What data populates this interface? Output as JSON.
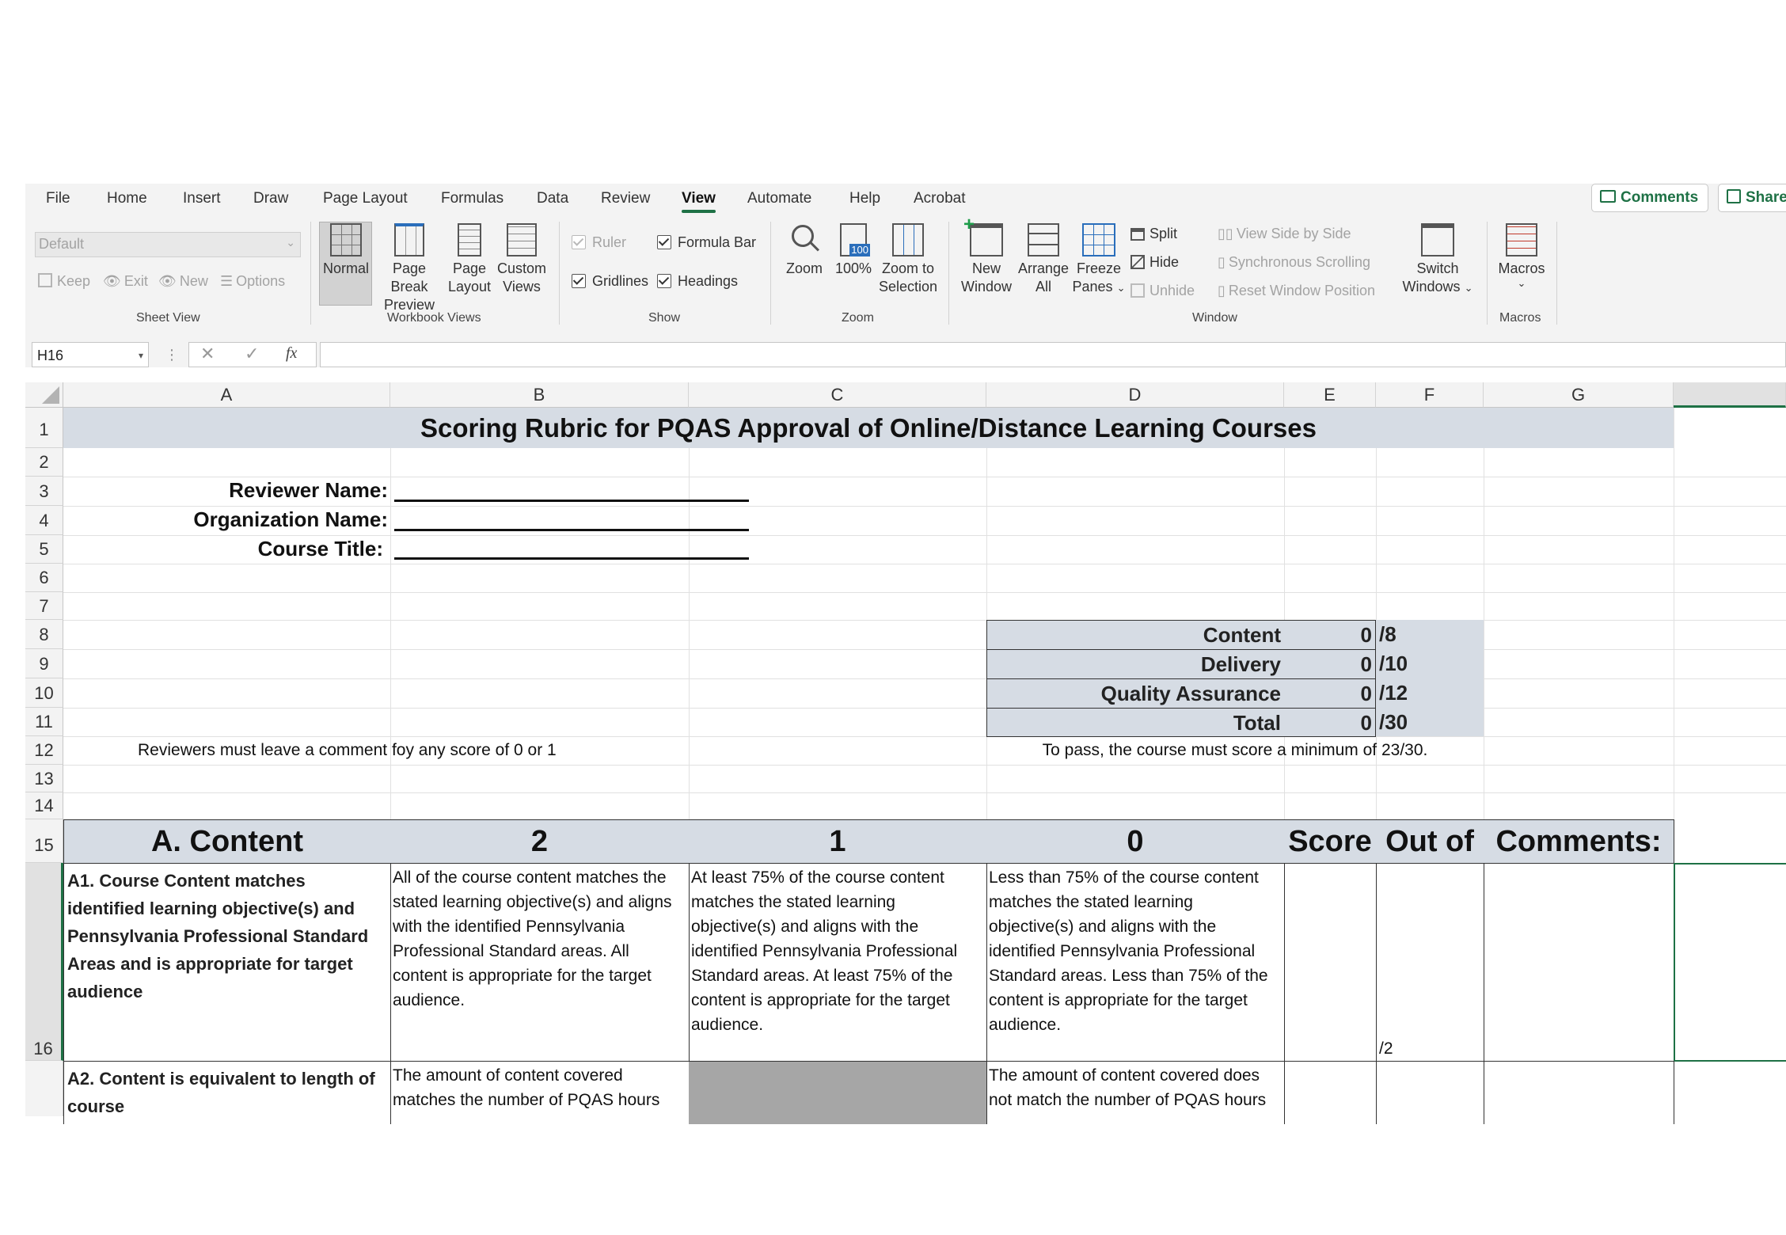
{
  "tabs": [
    "File",
    "Home",
    "Insert",
    "Draw",
    "Page Layout",
    "Formulas",
    "Data",
    "Review",
    "View",
    "Automate",
    "Help",
    "Acrobat"
  ],
  "active_tab": "View",
  "top_buttons": {
    "comments": "Comments",
    "share": "Share"
  },
  "ribbon": {
    "sheet_view": {
      "dropdown_value": "Default",
      "keep": "Keep",
      "exit": "Exit",
      "new": "New",
      "options": "Options",
      "group_label": "Sheet View"
    },
    "workbook_views": {
      "normal": "Normal",
      "page_break_1": "Page Break",
      "page_break_2": "Preview",
      "page_layout_1": "Page",
      "page_layout_2": "Layout",
      "custom_1": "Custom",
      "custom_2": "Views",
      "group_label": "Workbook Views"
    },
    "show": {
      "ruler": "Ruler",
      "formula_bar": "Formula Bar",
      "gridlines": "Gridlines",
      "headings": "Headings",
      "group_label": "Show"
    },
    "zoom": {
      "zoom": "Zoom",
      "hundred": "100%",
      "zoom_sel_1": "Zoom to",
      "zoom_sel_2": "Selection",
      "group_label": "Zoom",
      "icon_text": "100"
    },
    "window": {
      "new_1": "New",
      "new_2": "Window",
      "arrange_1": "Arrange",
      "arrange_2": "All",
      "freeze_1": "Freeze",
      "freeze_2": "Panes",
      "split": "Split",
      "hide": "Hide",
      "unhide": "Unhide",
      "side_by_side": "View Side by Side",
      "sync_scroll": "Synchronous Scrolling",
      "reset_pos": "Reset Window Position",
      "switch_1": "Switch",
      "switch_2": "Windows",
      "group_label": "Window"
    },
    "macros": {
      "macros": "Macros",
      "group_label": "Macros"
    }
  },
  "formula_bar": {
    "name_box": "H16",
    "fx": "fx",
    "content": ""
  },
  "columns": [
    "A",
    "B",
    "C",
    "D",
    "E",
    "F",
    "G"
  ],
  "rows": [
    "1",
    "2",
    "3",
    "4",
    "5",
    "6",
    "7",
    "8",
    "9",
    "10",
    "11",
    "12",
    "13",
    "14",
    "15",
    "16"
  ],
  "sheet": {
    "title": "Scoring Rubric for PQAS Approval of Online/Distance Learning Courses",
    "reviewer_label": "Reviewer Name:",
    "org_label": "Organization Name:",
    "course_label": "Course Title:",
    "summary": [
      {
        "label": "Content",
        "score": "0",
        "out_of": "/8"
      },
      {
        "label": "Delivery",
        "score": "0",
        "out_of": "/10"
      },
      {
        "label": "Quality Assurance",
        "score": "0",
        "out_of": "/12"
      },
      {
        "label": "Total",
        "score": "0",
        "out_of": "/30"
      }
    ],
    "note_left": "Reviewers must leave a comment foy any score of 0 or 1",
    "note_right": "To pass, the course must score a minimum of  23/30.",
    "header": {
      "a": "A. Content",
      "b": "2",
      "c": "1",
      "d": "0",
      "e": "Score",
      "f": "Out of",
      "g": "Comments:"
    },
    "row16": {
      "a": "A1. Course Content matches identified learning objective(s) and Pennsylvania Professional Standard Areas and is appropriate for target audience",
      "b": "All of the course content matches the stated learning objective(s) and aligns with the identified Pennsylvania Professional Standard areas. All content is appropriate for the target audience.",
      "c": "At least 75% of the course content matches the stated learning objective(s) and aligns with the identified Pennsylvania Professional Standard areas. At least 75% of the content is appropriate for the target audience.",
      "d": "Less than 75% of the course content matches the stated learning objective(s) and aligns with the identified Pennsylvania Professional Standard areas. Less than 75% of the content is appropriate for the target audience.",
      "f": "/2"
    },
    "row17": {
      "a": "A2. Content is equivalent to length of course",
      "b": "The amount of content covered matches the number of PQAS hours",
      "d": "The amount of content covered does not match the number of PQAS hours"
    }
  }
}
